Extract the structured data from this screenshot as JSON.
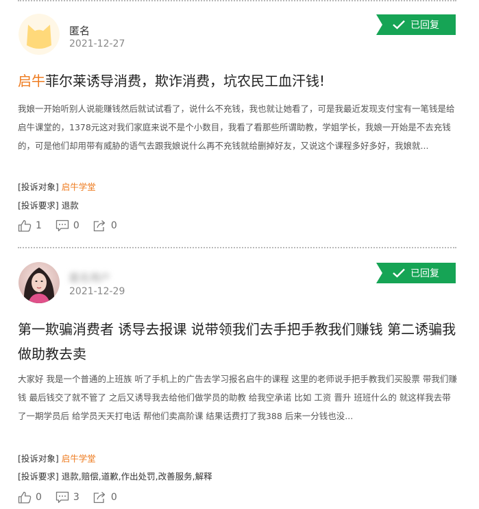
{
  "posts": [
    {
      "username": "匿名",
      "date": "2021-12-27",
      "status": "已回复",
      "title_brand": "启牛",
      "title_rest": "菲尔莱诱导消费，欺诈消费，坑农民工血汗钱!",
      "title_full": "",
      "body": "我娘一开始听别人说能赚钱然后就试试看了，说什么不充钱，我也就让她看了，可是我最近发现支付宝有一笔钱是给启牛课堂的，1378元这对我们家庭来说不是个小数目，我看了看那些所谓助教，学姐学长，我娘一开始是不去充钱的，可是他们却用带有威胁的语气去跟我娘说什么再不充钱就给删掉好友，又说这个课程多好多好，我娘就...",
      "target_label": "[投诉对象]",
      "target_value": "启牛学堂",
      "request_label": "[投诉要求]",
      "request_value": "退款",
      "likes": "1",
      "comments": "0",
      "shares": "0"
    },
    {
      "username": "匿名用户",
      "date": "2021-12-29",
      "status": "已回复",
      "title_brand": "",
      "title_rest": "",
      "title_full": "第一欺骗消费者 诱导去报课 说带领我们去手把手教我们赚钱 第二诱骗我做助教去卖",
      "body": "大家好 我是一个普通的上班族 听了手机上的广告去学习报名启牛的课程 这里的老师说手把手教我们买股票 带我们赚钱 最后钱交了就不管了 之后又诱导我去给他们做学员的助教 给我空承诺 比如 工资 晋升 班班什么的 就这样我去带了一期学员后 给学员天天打电话 帮他们卖高阶课 结果话费打了我388 后来一分钱也没...",
      "target_label": "[投诉对象]",
      "target_value": "启牛学堂",
      "request_label": "[投诉要求]",
      "request_value": "退款,赔偿,道歉,作出处罚,改善服务,解释",
      "likes": "0",
      "comments": "3",
      "shares": "0"
    }
  ],
  "colors": {
    "accent": "#ee7b1f",
    "badge": "#16a455",
    "divider": "#b9b9b9"
  },
  "icons": {
    "status": "check-icon",
    "like": "thumbs-up-icon",
    "comment": "comment-icon",
    "share": "share-icon"
  }
}
